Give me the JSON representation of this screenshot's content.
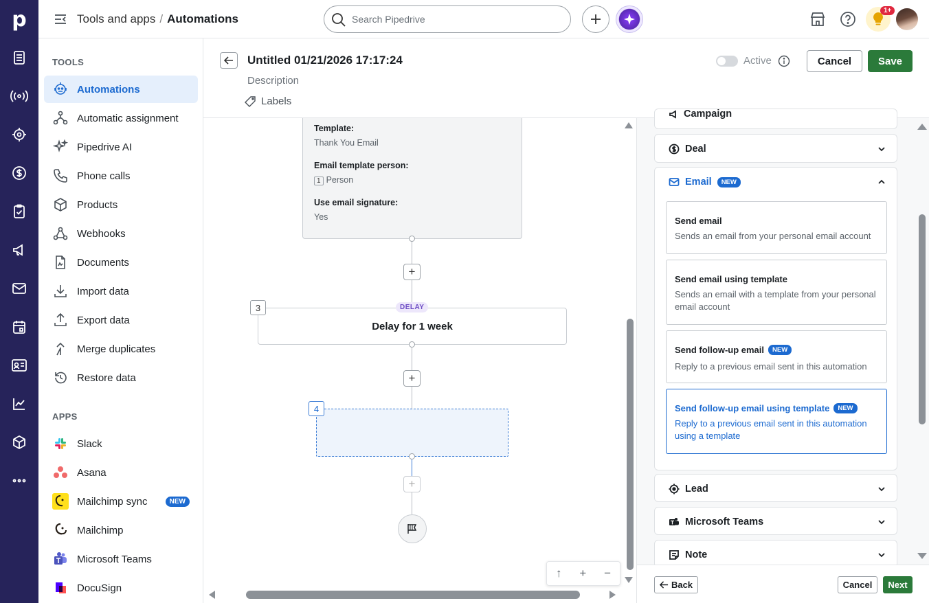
{
  "rail": {
    "logo": "p"
  },
  "topbar": {
    "breadcrumb_parent": "Tools and apps",
    "breadcrumb_sep": "/",
    "breadcrumb_current": "Automations",
    "search_placeholder": "Search Pipedrive",
    "notification_count": "1+"
  },
  "sidebar": {
    "tools_header": "TOOLS",
    "tools": [
      {
        "label": "Automations"
      },
      {
        "label": "Automatic assignment"
      },
      {
        "label": "Pipedrive AI"
      },
      {
        "label": "Phone calls"
      },
      {
        "label": "Products"
      },
      {
        "label": "Webhooks"
      },
      {
        "label": "Documents"
      },
      {
        "label": "Import data"
      },
      {
        "label": "Export data"
      },
      {
        "label": "Merge duplicates"
      },
      {
        "label": "Restore data"
      }
    ],
    "apps_header": "APPS",
    "apps": [
      {
        "label": "Slack"
      },
      {
        "label": "Asana"
      },
      {
        "label": "Mailchimp sync",
        "badge": "NEW"
      },
      {
        "label": "Mailchimp"
      },
      {
        "label": "Microsoft Teams"
      },
      {
        "label": "DocuSign"
      }
    ]
  },
  "editor": {
    "title": "Untitled 01/21/2026 17:17:24",
    "description_placeholder": "Description",
    "labels": "Labels",
    "active_label": "Active",
    "cancel": "Cancel",
    "save": "Save"
  },
  "canvas": {
    "card1": {
      "template_key": "Template:",
      "template_val": "Thank You Email",
      "person_key": "Email template person:",
      "person_num": "1",
      "person_val": "Person",
      "sig_key": "Use email signature:",
      "sig_val": "Yes"
    },
    "step3": {
      "num": "3",
      "tag": "DELAY",
      "label": "Delay for 1 week"
    },
    "step4": {
      "num": "4"
    },
    "add_symbol": "+",
    "zoom": {
      "up": "↑",
      "plus": "+",
      "minus": "−"
    }
  },
  "panel": {
    "campaign": "Campaign",
    "deal": "Deal",
    "email": "Email",
    "email_badge": "NEW",
    "options": [
      {
        "title": "Send email",
        "desc": "Sends an email from your personal email account"
      },
      {
        "title": "Send email using template",
        "desc": "Sends an email with a template from your personal email account"
      },
      {
        "title": "Send follow-up email",
        "badge": "NEW",
        "desc": "Reply to a previous email sent in this automation"
      },
      {
        "title": "Send follow-up email using template",
        "badge": "NEW",
        "desc": "Reply to a previous email sent in this automation using a template"
      }
    ],
    "lead": "Lead",
    "teams": "Microsoft Teams",
    "note": "Note",
    "footer": {
      "back": "Back",
      "cancel": "Cancel",
      "next": "Next"
    }
  },
  "colors": {
    "rail": "#26235a",
    "accent": "#1c6ad0",
    "save_green": "#2b7a3a",
    "active_bg": "#e5effc"
  }
}
